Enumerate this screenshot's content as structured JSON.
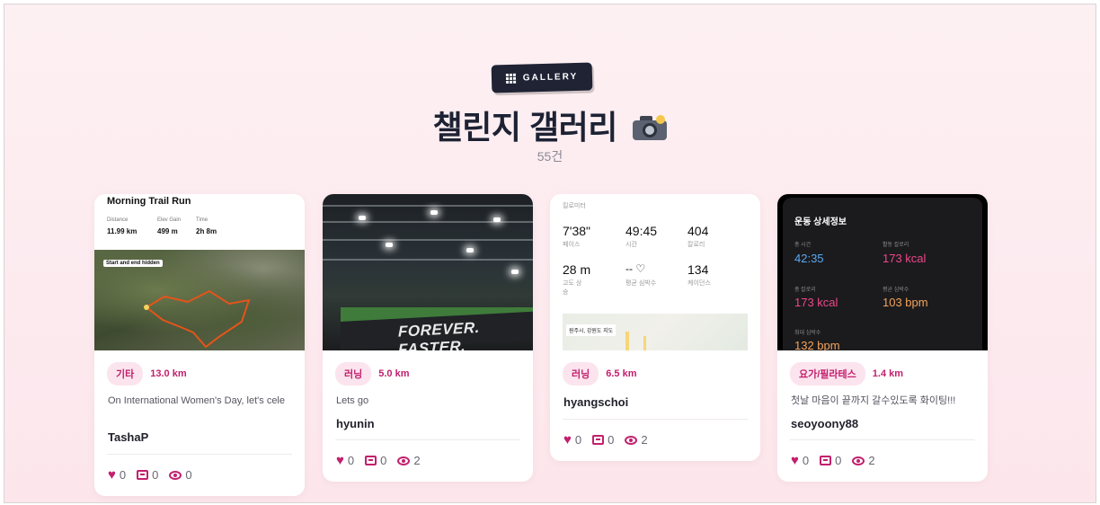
{
  "header": {
    "badge_label": "GALLERY",
    "title": "챌린지 갤러리",
    "count": "55건"
  },
  "icons": [
    "grid-icon",
    "camera-icon",
    "heart-icon",
    "comment-icon",
    "eye-icon"
  ],
  "colors": {
    "accent": "#c2206d",
    "badge_bg": "#1f2333",
    "page_bg": "#fce6ec"
  },
  "cards": [
    {
      "category": "기타",
      "distance": "13.0 km",
      "description": "On International Women's Day, let's cele",
      "user": "TashaP",
      "likes": "0",
      "comments": "0",
      "views": "0",
      "thumb": {
        "title": "Morning Trail Run",
        "stats": [
          {
            "label": "Distance",
            "value": "11.99 km"
          },
          {
            "label": "Elev Gain",
            "value": "499 m"
          },
          {
            "label": "Time",
            "value": "2h 8m"
          }
        ],
        "map_label": "Start and end hidden"
      }
    },
    {
      "category": "러닝",
      "distance": "5.0 km",
      "description": "Lets go",
      "user": "hyunin",
      "likes": "0",
      "comments": "0",
      "views": "2",
      "thumb": {
        "banner": "FOREVER. FASTER."
      }
    },
    {
      "category": "러닝",
      "distance": "6.5 km",
      "description": "",
      "user": "hyangschoi",
      "likes": "0",
      "comments": "0",
      "views": "2",
      "thumb": {
        "header": "킬로미터",
        "metrics": [
          {
            "value": "7'38\"",
            "label": "페이스"
          },
          {
            "value": "49:45",
            "label": "시간"
          },
          {
            "value": "404",
            "label": "칼로리"
          },
          {
            "value": "28 m",
            "label": "고도 상승"
          },
          {
            "value": "-- ♡",
            "label": "평균 심박수"
          },
          {
            "value": "134",
            "label": "케이던스"
          }
        ],
        "map_label": "원주시, 강원도 지도"
      }
    },
    {
      "category": "요가/필라테스",
      "distance": "1.4 km",
      "description": "첫날 마음이 끝까지 갈수있도록 화이팅!!!",
      "user": "seoyoony88",
      "likes": "0",
      "comments": "0",
      "views": "2",
      "thumb": {
        "header": "운동 상세정보",
        "metrics": [
          {
            "label": "총 시간",
            "value": "42:35",
            "color": "#5aa9f5"
          },
          {
            "label": "활동 칼로리",
            "value": "173 kcal",
            "color": "#f0468a"
          },
          {
            "label": "총 칼로리",
            "value": "173 kcal",
            "color": "#f0468a"
          },
          {
            "label": "평균 심박수",
            "value": "103 bpm",
            "color": "#f5a35c"
          },
          {
            "label": "최대 심박수",
            "value": "132 bpm",
            "color": "#f5a35c"
          }
        ]
      }
    }
  ]
}
